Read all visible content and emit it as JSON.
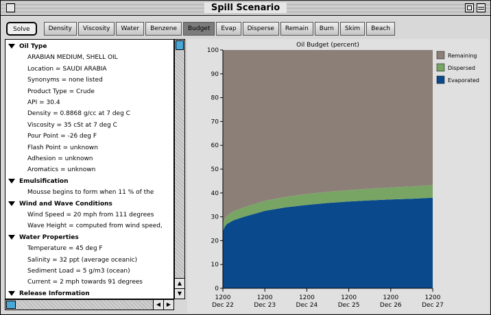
{
  "window": {
    "title": "Spill Scenario"
  },
  "toolbar": {
    "buttons": [
      {
        "label": "Solve"
      },
      {
        "label": "Density"
      },
      {
        "label": "Viscosity"
      },
      {
        "label": "Water"
      },
      {
        "label": "Benzene"
      },
      {
        "label": "Budget"
      },
      {
        "label": "Evap"
      },
      {
        "label": "Disperse"
      },
      {
        "label": "Remain"
      },
      {
        "label": "Burn"
      },
      {
        "label": "Skim"
      },
      {
        "label": "Beach"
      }
    ],
    "active_button": "Budget"
  },
  "tree": {
    "rows": [
      {
        "text": "Oil Type",
        "section": true
      },
      {
        "text": "ARABIAN MEDIUM, SHELL OIL"
      },
      {
        "text": "Location = SAUDI ARABIA"
      },
      {
        "text": "Synonyms = none listed"
      },
      {
        "text": "Product Type = Crude"
      },
      {
        "text": "API = 30.4"
      },
      {
        "text": "Density = 0.8868 g/cc at 7 deg C"
      },
      {
        "text": "Viscosity = 35 cSt at 7 deg C"
      },
      {
        "text": "Pour Point = -26 deg F"
      },
      {
        "text": "Flash Point = unknown"
      },
      {
        "text": "Adhesion = unknown"
      },
      {
        "text": "Aromatics = unknown"
      },
      {
        "text": "Emulsification",
        "section": true
      },
      {
        "text": "Mousse begins to form when 11 % of the"
      },
      {
        "text": "Wind and Wave Conditions",
        "section": true
      },
      {
        "text": "Wind Speed = 20 mph from 111 degrees"
      },
      {
        "text": "Wave Height = computed from wind speed,"
      },
      {
        "text": "Water Properties",
        "section": true
      },
      {
        "text": "Temperature = 45 deg F"
      },
      {
        "text": "Salinity = 32 ppt (average oceanic)"
      },
      {
        "text": "Sediment Load = 5 g/m3 (ocean)"
      },
      {
        "text": "Current = 2 mph towards 91 degrees"
      },
      {
        "text": "Release Information",
        "section": true
      }
    ]
  },
  "colors": {
    "remaining": "#8c7f77",
    "dispersed": "#78a564",
    "evaporated": "#0a4a8c",
    "scroll_thumb": "#4aa8d8"
  },
  "chart_data": {
    "type": "area",
    "title": "Oil Budget (percent)",
    "x": [
      0,
      0.05,
      0.1,
      0.25,
      0.5,
      1,
      1.5,
      2,
      2.5,
      3,
      3.5,
      4,
      4.5,
      5
    ],
    "x_tick_labels": [
      {
        "top": "1200",
        "bottom": "Dec 22"
      },
      {
        "top": "1200",
        "bottom": "Dec 23"
      },
      {
        "top": "1200",
        "bottom": "Dec 24"
      },
      {
        "top": "1200",
        "bottom": "Dec 25"
      },
      {
        "top": "1200",
        "bottom": "Dec 26"
      },
      {
        "top": "1200",
        "bottom": "Dec 27"
      }
    ],
    "y_ticks": [
      0,
      10,
      20,
      30,
      40,
      50,
      60,
      70,
      80,
      90,
      100
    ],
    "ylim": [
      0,
      100
    ],
    "series": [
      {
        "name": "Evaporated",
        "values": [
          24,
          26,
          27,
          28.5,
          30,
          32.5,
          34,
          35,
          35.8,
          36.4,
          36.9,
          37.3,
          37.6,
          38
        ]
      },
      {
        "name": "Dispersed",
        "values": [
          3,
          3.3,
          3.5,
          3.8,
          4,
          4.2,
          4.4,
          4.6,
          4.7,
          4.8,
          4.9,
          5,
          5.1,
          5.3
        ]
      },
      {
        "name": "Remaining",
        "values": [
          73,
          70.7,
          69.5,
          67.7,
          66,
          63.3,
          61.6,
          60.4,
          59.5,
          58.8,
          58.2,
          57.7,
          57.3,
          56.7
        ]
      }
    ],
    "legend": [
      {
        "label": "Remaining"
      },
      {
        "label": "Dispersed"
      },
      {
        "label": "Evaporated"
      }
    ],
    "legend_position": "right",
    "stacked": true,
    "grid": false
  }
}
